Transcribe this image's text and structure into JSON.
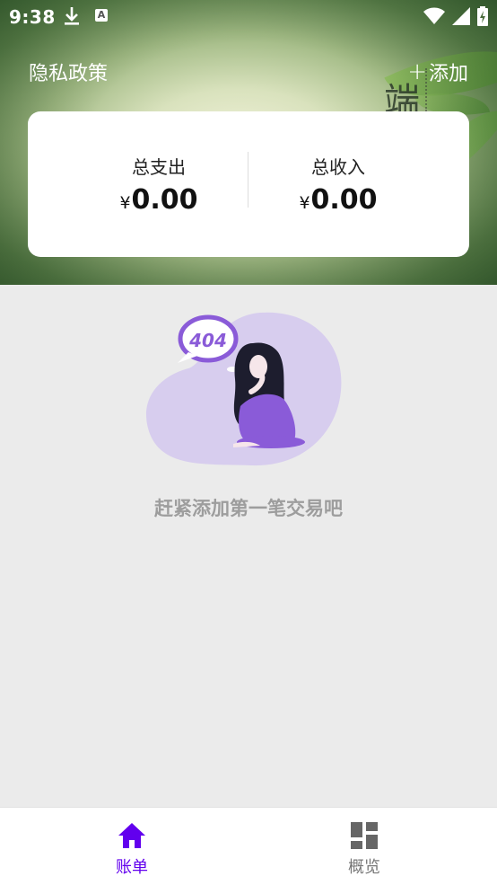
{
  "status_bar": {
    "time": "9:38",
    "icons": [
      "download-icon",
      "a-icon",
      "wifi-icon",
      "signal-icon",
      "battery-icon"
    ]
  },
  "header": {
    "privacy_label": "隐私政策",
    "add_label": "添加",
    "add_icon": "plus-icon"
  },
  "summary": {
    "expense_label": "总支出",
    "expense_currency": "¥",
    "expense_value": "0.00",
    "income_label": "总收入",
    "income_currency": "¥",
    "income_value": "0.00"
  },
  "empty_state": {
    "bubble_text": "404",
    "message": "赶紧添加第一笔交易吧"
  },
  "bottom_nav": {
    "tabs": [
      {
        "label": "账单",
        "icon": "home-icon",
        "active": true
      },
      {
        "label": "概览",
        "icon": "dashboard-icon",
        "active": false
      }
    ],
    "active_color": "#6200ee",
    "inactive_color": "#777777"
  },
  "colors": {
    "accent": "#6200ee",
    "illustration_purple": "#d7cdee",
    "illustration_dark_purple": "#8a5bd8"
  }
}
